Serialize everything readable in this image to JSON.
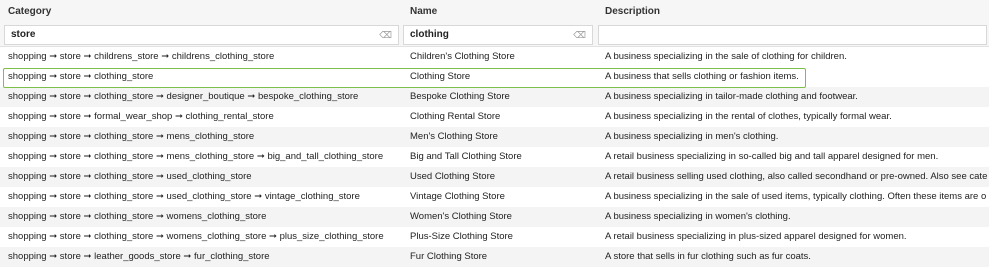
{
  "columns": {
    "category": "Category",
    "name": "Name",
    "description": "Description"
  },
  "filters": {
    "category": "store",
    "name": "clothing",
    "description": ""
  },
  "filter_icon": "filter-icon",
  "highlight_color": "#7cbf4a",
  "rows": [
    {
      "category": "shopping ➞ store ➞ childrens_store ➞ childrens_clothing_store",
      "name": "Children's Clothing Store",
      "description": "A business specializing in the sale of clothing for children."
    },
    {
      "category": "shopping ➞ store ➞ clothing_store",
      "name": "Clothing Store",
      "description": "A business that sells clothing or fashion items."
    },
    {
      "category": "shopping ➞ store ➞ clothing_store ➞ designer_boutique ➞ bespoke_clothing_store",
      "name": "Bespoke Clothing Store",
      "description": "A business specializing in tailor-made clothing and footwear."
    },
    {
      "category": "shopping ➞ store ➞ formal_wear_shop ➞ clothing_rental_store",
      "name": "Clothing Rental Store",
      "description": "A business specializing in the rental of clothes, typically formal wear."
    },
    {
      "category": "shopping ➞ store ➞ clothing_store ➞ mens_clothing_store",
      "name": "Men's Clothing Store",
      "description": "A business specializing in men's clothing."
    },
    {
      "category": "shopping ➞ store ➞ clothing_store ➞ mens_clothing_store ➞ big_and_tall_clothing_store",
      "name": "Big and Tall Clothing Store",
      "description": "A retail business specializing in so-called big and tall apparel designed for men."
    },
    {
      "category": "shopping ➞ store ➞ clothing_store ➞ used_clothing_store",
      "name": "Used Clothing Store",
      "description": "A retail business selling used clothing, also called secondhand or pre-owned. Also see cate"
    },
    {
      "category": "shopping ➞ store ➞ clothing_store ➞ used_clothing_store ➞ vintage_clothing_store",
      "name": "Vintage Clothing Store",
      "description": "A business specializing in the sale of used items, typically clothing. Often these items are o"
    },
    {
      "category": "shopping ➞ store ➞ clothing_store ➞ womens_clothing_store",
      "name": "Women's Clothing Store",
      "description": "A business specializing in women's clothing."
    },
    {
      "category": "shopping ➞ store ➞ clothing_store ➞ womens_clothing_store ➞ plus_size_clothing_store",
      "name": "Plus-Size Clothing Store",
      "description": "A retail business specializing in plus-sized apparel designed for women."
    },
    {
      "category": "shopping ➞ store ➞ leather_goods_store ➞ fur_clothing_store",
      "name": "Fur Clothing Store",
      "description": "A store that sells in fur clothing such as fur coats."
    }
  ]
}
